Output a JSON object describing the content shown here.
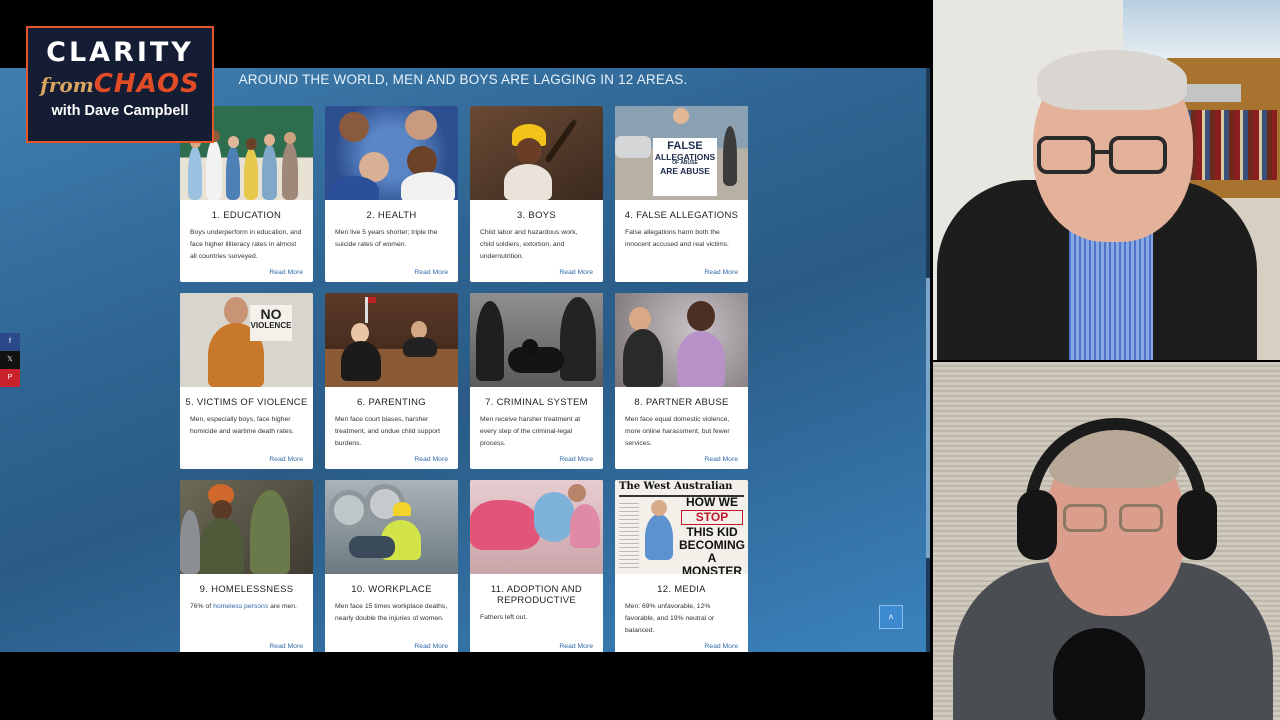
{
  "logo": {
    "line1": "CLARITY",
    "from": "from",
    "chaos": "CHAOS",
    "line3": "with Dave Campbell"
  },
  "page": {
    "headline": "AROUND THE WORLD, MEN AND BOYS ARE LAGGING IN 12 AREAS.",
    "read_more": "Read More",
    "back_to_top": "˄",
    "social": {
      "facebook": "f",
      "x": "𝕏",
      "pinterest": "P"
    }
  },
  "cards": [
    {
      "title": "1. EDUCATION",
      "desc": "Boys underperform in education, and face higher illiteracy rates in almost all countries surveyed."
    },
    {
      "title": "2. HEALTH",
      "desc": "Men live 5 years shorter;  triple the suicide rates of women."
    },
    {
      "title": "3. BOYS",
      "desc": "Child labor and hazardous work, child soldiers, extortion, and undernutrition."
    },
    {
      "title": "4. FALSE ALLEGATIONS",
      "desc": "False allegations harm both the innocent accused and real victims."
    },
    {
      "title": "5. VICTIMS OF VIOLENCE",
      "desc": "Men, especially boys, face higher homicide and wartime death rates."
    },
    {
      "title": "6. PARENTING",
      "desc": "Men face court biases, harsher treatment, and undue child support burdens."
    },
    {
      "title": "7. CRIMINAL SYSTEM",
      "desc": "Men receive harsher treatment at every step of the criminal-legal process."
    },
    {
      "title": "8. PARTNER ABUSE",
      "desc": "Men face equal domestic violence, more online harassment, but fewer services."
    },
    {
      "title": "9. HOMELESSNESS",
      "desc_pre": "76% of ",
      "desc_link": "homeless persons",
      "desc_post": " are men."
    },
    {
      "title": "10. WORKPLACE",
      "desc": "Men face 15 times workplace deaths, nearly double the injuries of women."
    },
    {
      "title": "11. ADOPTION AND REPRODUCTIVE",
      "desc": "Fathers left out."
    },
    {
      "title": "12. MEDIA",
      "desc": "Men: 69% unfavorable, 12% favorable, and 19% neutral or balanced."
    }
  ],
  "image_text": {
    "sign5a": "NO",
    "sign5b": "VIOLENCE",
    "sign4a": "FALSE",
    "sign4b": "ALLEGATIONS",
    "sign4c": "OF ABUSE",
    "sign4d": "ARE ABUSE",
    "paper_name": "The West Australian",
    "paper_h1": "HOW WE",
    "paper_h2": "STOP",
    "paper_h3": "THIS KID",
    "paper_h4": "BECOMING",
    "paper_h5": "A MONSTER"
  }
}
